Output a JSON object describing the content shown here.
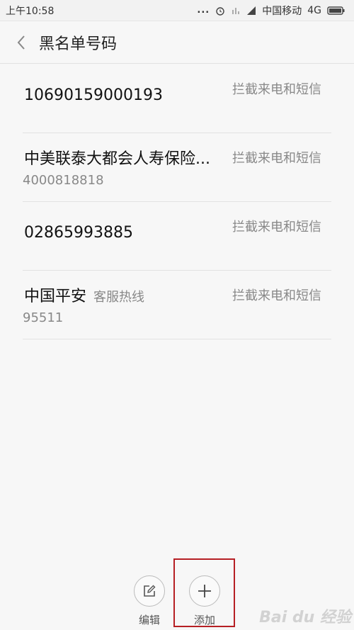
{
  "status_bar": {
    "time": "上午10:58",
    "dots": "...",
    "carrier": "中国移动",
    "network": "4G"
  },
  "header": {
    "title": "黑名单号码"
  },
  "blacklist": [
    {
      "name": "10690159000193",
      "tag": "",
      "number": "",
      "rule": "拦截来电和短信"
    },
    {
      "name": "中美联泰大都会人寿保险...",
      "tag": "",
      "number": "4000818818",
      "rule": "拦截来电和短信"
    },
    {
      "name": "02865993885",
      "tag": "",
      "number": "",
      "rule": "拦截来电和短信"
    },
    {
      "name": "中国平安",
      "tag": "客服热线",
      "number": "95511",
      "rule": "拦截来电和短信"
    }
  ],
  "bottom_bar": {
    "edit_label": "编辑",
    "add_label": "添加"
  },
  "watermark": "Bai du 经验"
}
